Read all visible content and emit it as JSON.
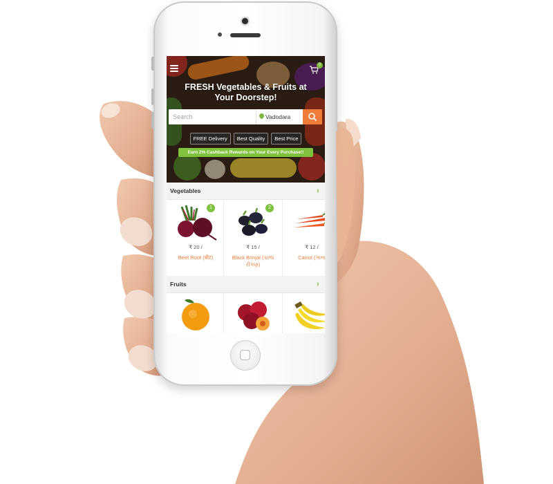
{
  "colors": {
    "accent_orange": "#f07c3a",
    "accent_green": "#7ec23e",
    "phone_body": "#ffffff",
    "skin": "#e9b99c"
  },
  "header": {
    "menu_icon": "hamburger-icon",
    "cart_icon": "cart-icon",
    "cart_count": "0",
    "title_line1": "FRESH Vegetables & Fruits at",
    "title_line2": "Your Doorstep!"
  },
  "search": {
    "placeholder": "Search",
    "city": "Vadodara",
    "pin_icon": "location-pin-icon",
    "button_icon": "search-icon"
  },
  "badges": [
    "FREE Delivery",
    "Best Quality",
    "Best Price"
  ],
  "cashback": "Earn 2% Cashback Rewards on Your Every Purchase!!",
  "sections": {
    "vegetables": {
      "title": "Vegetables",
      "items": [
        {
          "qty": "1",
          "price": "₹ 20 /",
          "name": "Beet Root (बीट)"
        },
        {
          "qty": "2",
          "price": "₹ 15 /",
          "name": "Black Brinjal (કાળા રીંગણ)"
        },
        {
          "qty": "",
          "price": "₹ 12 /",
          "name": "Carrot (ગાજ"
        }
      ]
    },
    "fruits": {
      "title": "Fruits",
      "items": [
        {
          "name": "orange"
        },
        {
          "name": "plums"
        },
        {
          "name": "bananas"
        }
      ]
    }
  }
}
